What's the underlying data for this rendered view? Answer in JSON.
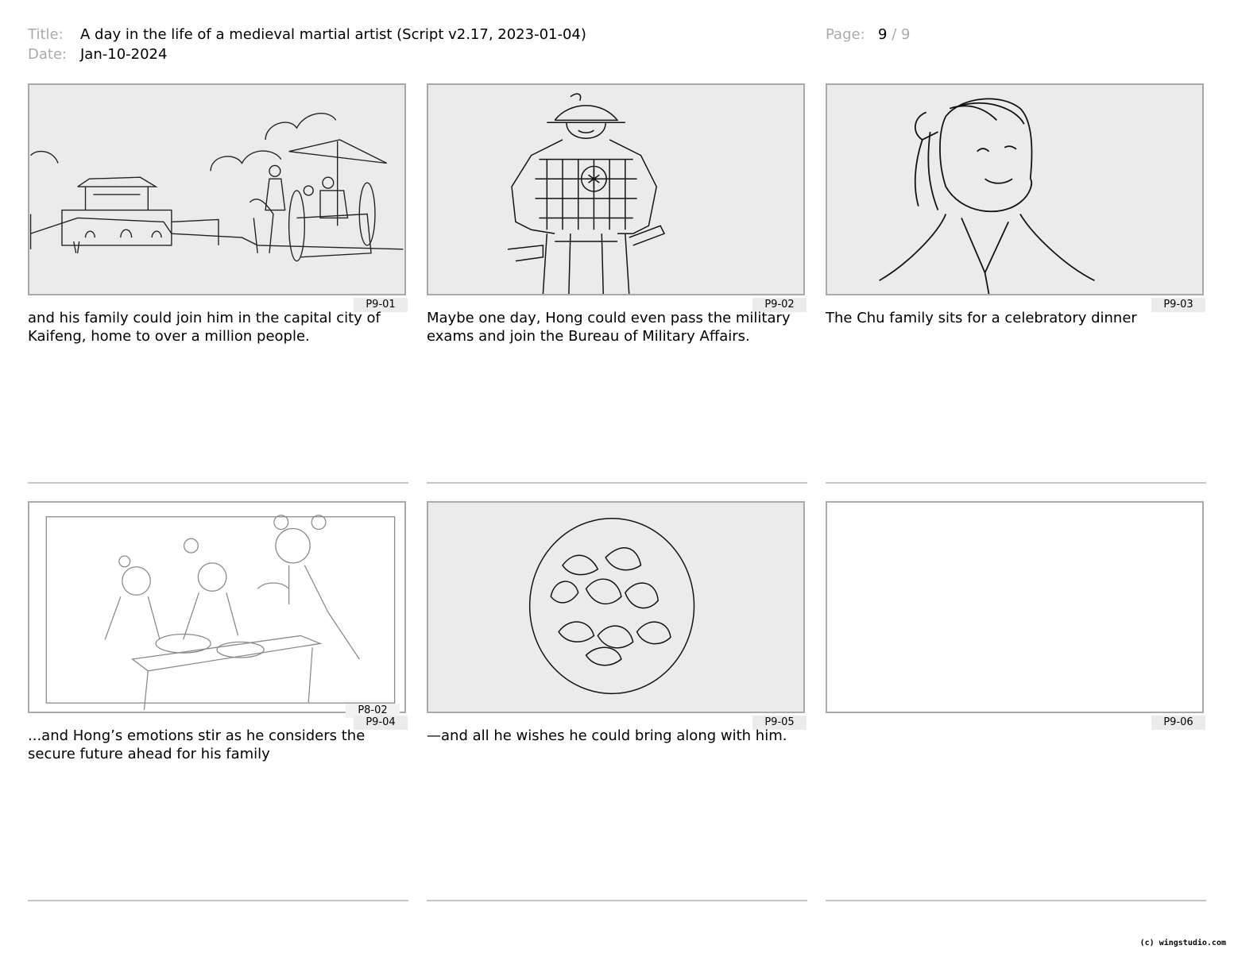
{
  "header": {
    "title_label": "Title:",
    "title": "A day in the life of a medieval martial artist (Script v2.17, 2023-01-04)",
    "date_label": "Date:",
    "date": "Jan-10-2024",
    "page_label": "Page:",
    "page_current": "9",
    "page_sep": "/",
    "page_total": "9"
  },
  "panels": [
    {
      "id": "P9-01",
      "caption": "and his family could join him in the capital city of Kaifeng, home to over a million people."
    },
    {
      "id": "P9-02",
      "caption": "Maybe one day, Hong could even pass the military exams and join the Bureau of Military Affairs."
    },
    {
      "id": "P9-03",
      "caption": "The Chu family sits for a celebratory dinner"
    },
    {
      "id": "P9-04",
      "ref_id": "P8-02",
      "caption": "...and Hong’s emotions stir as he considers the secure future ahead for his family"
    },
    {
      "id": "P9-05",
      "caption": "—and all he wishes he could bring along with him."
    },
    {
      "id": "P9-06",
      "caption": ""
    }
  ],
  "footer": "(c) wingstudio.com"
}
